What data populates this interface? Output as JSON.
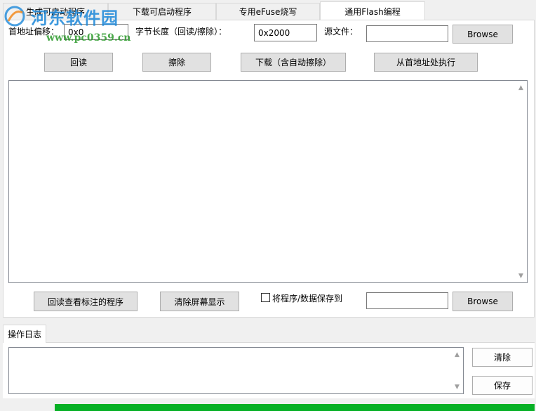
{
  "tabs": [
    {
      "label": "生成可启动程序"
    },
    {
      "label": "下载可启动程序"
    },
    {
      "label": "专用eFuse烧写"
    },
    {
      "label": "通用Flash编程"
    }
  ],
  "flash": {
    "offset_label": "首地址偏移：",
    "offset_value": "0x0",
    "length_label": "字节长度（回读/擦除）：",
    "length_value": "0x2000",
    "source_label": "源文件：",
    "source_value": "",
    "browse_label": "Browse",
    "readback_button": "回读",
    "erase_button": "擦除",
    "download_button": "下载（含自动擦除）",
    "exec_button": "从首地址处执行",
    "readback_view_button": "回读查看标注的程序",
    "clear_screen_button": "清除屏幕显示",
    "save_checkbox_label": "将程序/数据保存到",
    "save_checked": false,
    "save_path_value": "",
    "browse2_label": "Browse"
  },
  "log": {
    "tab_label": "操作日志",
    "clear_button": "清除",
    "save_button": "保存"
  },
  "progress": {
    "fraction": 1.0,
    "color": "#06b025"
  },
  "watermark": {
    "title": "河东软件园",
    "url": "www.pc0359.cn",
    "color": "#1d88d9"
  }
}
